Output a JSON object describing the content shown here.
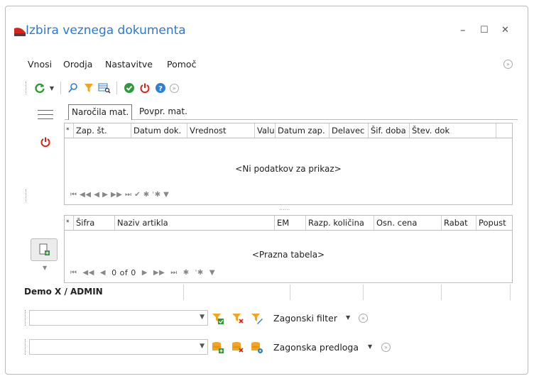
{
  "window": {
    "title": "Izbira veznega dokumenta",
    "minimize_glyph": "–",
    "maximize_glyph": "☐",
    "close_glyph": "✕"
  },
  "menu": {
    "items": [
      "Vnosi",
      "Orodja",
      "Nastavitve",
      "Pomoč"
    ]
  },
  "toolbar": {
    "icons": [
      "refresh-icon",
      "dropdown-arrow-icon",
      "search-icon",
      "filter-icon",
      "grid-search-icon",
      "confirm-icon",
      "power-icon",
      "help-icon",
      "more-icon"
    ]
  },
  "tabs": [
    {
      "label": "Naročila mat.",
      "active": true
    },
    {
      "label": "Povpr. mat.",
      "active": false
    }
  ],
  "top_grid": {
    "columns": [
      "*",
      "Zap. št.",
      "Datum dok.",
      "Vrednost",
      "Valu",
      "Datum zap.",
      "Delavec",
      "Šif. doba",
      "Štev. dok"
    ],
    "empty_text": "<Ni podatkov za prikaz>",
    "nav_symbols": "⏮ ◀◀ ◀ ▶ ▶▶ ⏭ ✔ ✱ '✱ ▼"
  },
  "bottom_grid": {
    "columns": [
      "*",
      "Šifra",
      "Naziv artikla",
      "EM",
      "Razp. količina",
      "Osn. cena",
      "Rabat",
      "Popust"
    ],
    "empty_text": "<Prazna tabela>",
    "record_counter": "0 of 0"
  },
  "splitter_dots": "......",
  "status": {
    "user_label": "Demo X / ADMIN"
  },
  "filter_row": {
    "label": "Zagonski filter",
    "value": ""
  },
  "template_row": {
    "label": "Zagonska predloga",
    "value": ""
  },
  "colors": {
    "title_blue": "#2a7ad5",
    "accent_green": "#2e9b3b",
    "power_red": "#d9241b",
    "filter_orange": "#f2a61d",
    "help_blue": "#2f7fd3"
  }
}
